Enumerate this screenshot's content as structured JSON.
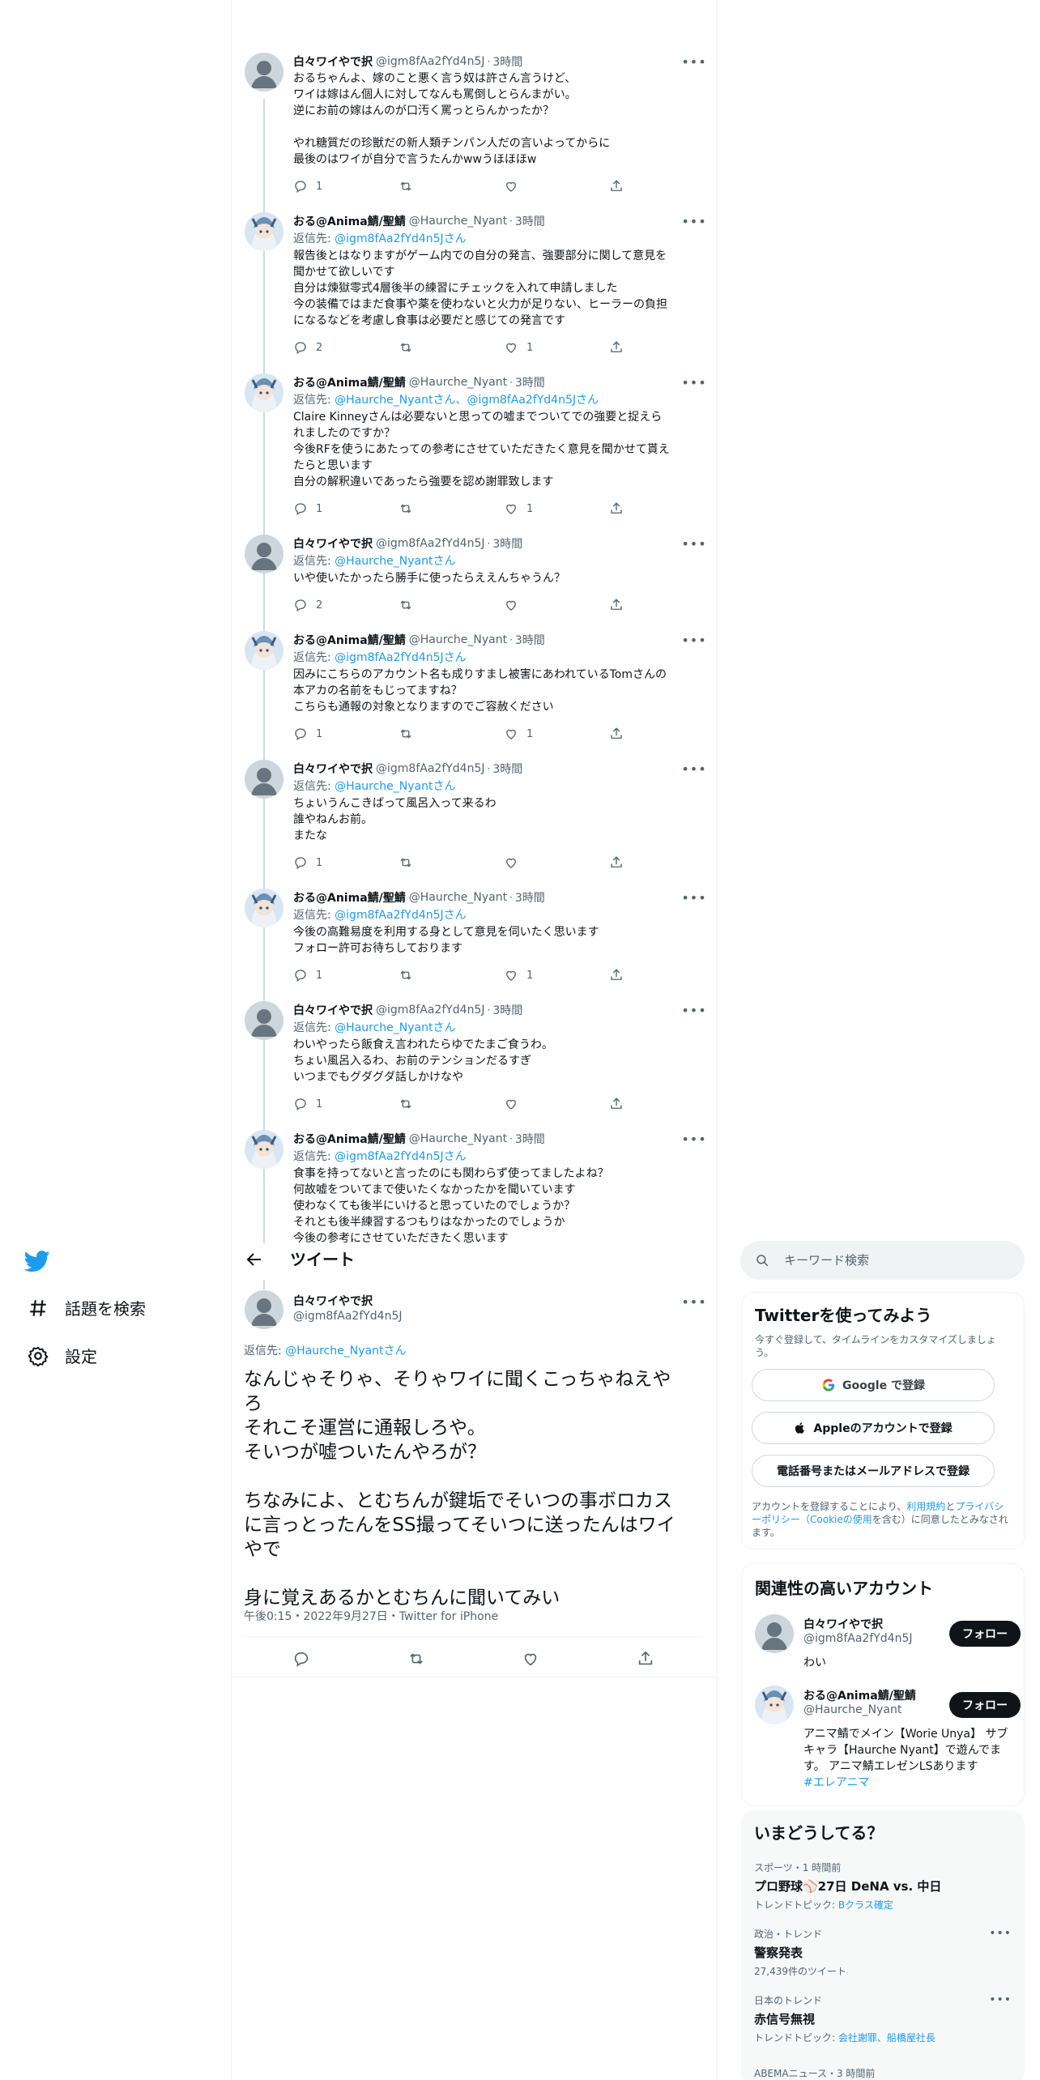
{
  "thread": {
    "tweets": [
      {
        "name": "白々ワイやで択",
        "handle": "@igm8fAa2fYd4n5J",
        "time": "3時間",
        "reply_label": "",
        "reply_to": "",
        "text": "おるちゃんよ、嫁のこと悪く言う奴は許さん言うけど、\nワイは嫁はん個人に対してなんも罵倒しとらんまがい。\n逆にお前の嫁はんのが口汚く罵っとらんかったか？\n\nやれ糖質だの珍獣だの新人類チンパン人だの言いよってからに\n最後のはワイが自分で言うたんかwwうほほほw",
        "replies": "1",
        "retweets": "",
        "likes": ""
      },
      {
        "name": "おる@Anima鯖/聖鯖",
        "handle": "@Haurche_Nyant",
        "time": "3時間",
        "reply_label": "返信先: ",
        "reply_to": "@igm8fAa2fYd4n5Jさん",
        "text": "報告後とはなりますがゲーム内での自分の発言、強要部分に関して意見を\n聞かせて欲しいです\n自分は煉獄零式4層後半の練習にチェックを入れて申請しました\n今の装備ではまだ食事や薬を使わないと火力が足りない、ヒーラーの負担\nになるなどを考慮し食事は必要だと感じての発言です",
        "replies": "2",
        "retweets": "",
        "likes": "1"
      },
      {
        "name": "おる@Anima鯖/聖鯖",
        "handle": "@Haurche_Nyant",
        "time": "3時間",
        "reply_label": "返信先: ",
        "reply_to": "@Haurche_Nyantさん、@igm8fAa2fYd4n5Jさん",
        "text": "Claire Kinneyさんは必要ないと思っての嘘までついてでの強要と捉えら\nれましたのですか？\n今後RFを使うにあたっての参考にさせていただきたく意見を聞かせて貰え\nたらと思います\n自分の解釈違いであったら強要を認め謝罪致します",
        "replies": "1",
        "retweets": "",
        "likes": "1"
      },
      {
        "name": "白々ワイやで択",
        "handle": "@igm8fAa2fYd4n5J",
        "time": "3時間",
        "reply_label": "返信先: ",
        "reply_to": "@Haurche_Nyantさん",
        "text": "いや使いたかったら勝手に使ったらええんちゃうん？",
        "replies": "2",
        "retweets": "",
        "likes": ""
      },
      {
        "name": "おる@Anima鯖/聖鯖",
        "handle": "@Haurche_Nyant",
        "time": "3時間",
        "reply_label": "返信先: ",
        "reply_to": "@igm8fAa2fYd4n5Jさん",
        "text": "因みにこちらのアカウント名も成りすまし被害にあわれているTomさんの\n本アカの名前をもじってますね？\nこちらも通報の対象となりますのでご容赦ください",
        "replies": "1",
        "retweets": "",
        "likes": "1"
      },
      {
        "name": "白々ワイやで択",
        "handle": "@igm8fAa2fYd4n5J",
        "time": "3時間",
        "reply_label": "返信先: ",
        "reply_to": "@Haurche_Nyantさん",
        "text": "ちょいうんこきばって風呂入って来るわ\n誰やねんお前。\nまたな",
        "replies": "1",
        "retweets": "",
        "likes": ""
      },
      {
        "name": "おる@Anima鯖/聖鯖",
        "handle": "@Haurche_Nyant",
        "time": "3時間",
        "reply_label": "返信先: ",
        "reply_to": "@igm8fAa2fYd4n5Jさん",
        "text": "今後の高難易度を利用する身として意見を伺いたく思います\nフォロー許可お待ちしております",
        "replies": "1",
        "retweets": "",
        "likes": "1"
      },
      {
        "name": "白々ワイやで択",
        "handle": "@igm8fAa2fYd4n5J",
        "time": "3時間",
        "reply_label": "返信先: ",
        "reply_to": "@Haurche_Nyantさん",
        "text": "わいやったら飯食え言われたらゆでたまご食うわ。\nちょい風呂入るわ、お前のテンションだるすぎ\nいつまでもグダグダ話しかけなや",
        "replies": "1",
        "retweets": "",
        "likes": ""
      },
      {
        "name": "おる@Anima鯖/聖鯖",
        "handle": "@Haurche_Nyant",
        "time": "3時間",
        "reply_label": "返信先: ",
        "reply_to": "@igm8fAa2fYd4n5Jさん",
        "text": "食事を持ってないと言ったのにも関わらず使ってましたよね？\n何故嘘をついてまで使いたくなかったかを聞いています\n使わなくても後半にいけると思っていたのでしょうか？\nそれとも後半練習するつもりはなかったのでしょうか\n今後の参考にさせていただきたく思います",
        "replies": "",
        "retweets": "",
        "likes": ""
      }
    ]
  },
  "nav": {
    "explore": "話題を検索",
    "settings": "設定"
  },
  "main": {
    "header_title": "ツイート",
    "name": "白々ワイやで択",
    "handle": "@igm8fAa2fYd4n5J",
    "reply_label": "返信先: ",
    "reply_to": "@Haurche_Nyantさん",
    "text": "なんじゃそりゃ、そりゃワイに聞くこっちゃねえや\nろ\nそれこそ運営に通報しろや。\nそいつが嘘ついたんやろが？\n\nちなみによ、とむちんが鍵垢でそいつの事ボロカス\nに言っとったんをSS撮ってそいつに送ったんはワイ\nやで\n\n身に覚えあるかとむちんに聞いてみい",
    "meta": "午後0:15・2022年9月27日・Twitter for iPhone"
  },
  "sidebar": {
    "search_placeholder": "キーワード検索",
    "signup": {
      "title": "Twitterを使ってみよう",
      "subtitle": "今すぐ登録して、タイムラインをカスタマイズしましょう。",
      "google": "Google で登録",
      "apple": "Appleのアカウントで登録",
      "phone": "電話番号またはメールアドレスで登録",
      "terms_pre": "アカウントを登録することにより、",
      "terms_link1": "利用規約",
      "terms_mid": "と",
      "terms_link2": "プライバシーポリシー（Cookieの使用",
      "terms_post": "を含む）に同意したとみなされます。"
    },
    "relevant": {
      "title": "関連性の高いアカウント",
      "follow": "フォロー",
      "accounts": [
        {
          "name": "白々ワイやで択",
          "handle": "@igm8fAa2fYd4n5J",
          "bio": "わい",
          "bio_tag": ""
        },
        {
          "name": "おる@Anima鯖/聖鯖",
          "handle": "@Haurche_Nyant",
          "bio": "アニマ鯖でメイン【Worie Unya】 サブキャラ【Haurche Nyant】で遊んでます。 アニマ鯖エレゼンLSあります",
          "bio_tag": "#エレアニマ"
        }
      ]
    },
    "trends": {
      "title": "いまどうしてる？",
      "items": [
        {
          "meta": "スポーツ・1 時間前",
          "name": "プロ野球⚾27日 DeNA vs. 中日",
          "sub_pre": "トレンドトピック: ",
          "sub_link": "Bクラス確定"
        },
        {
          "meta": "政治・トレンド",
          "name": "警察発表",
          "sub_pre": "27,439件のツイート",
          "sub_link": ""
        },
        {
          "meta": "日本のトレンド",
          "name": "赤信号無視",
          "sub_pre": "トレンドトピック: ",
          "sub_link": "会社謝罪、船橋屋社長"
        },
        {
          "meta": "ABEMAニュース・3 時間前",
          "name": "",
          "sub_pre": "",
          "sub_link": ""
        }
      ]
    }
  }
}
